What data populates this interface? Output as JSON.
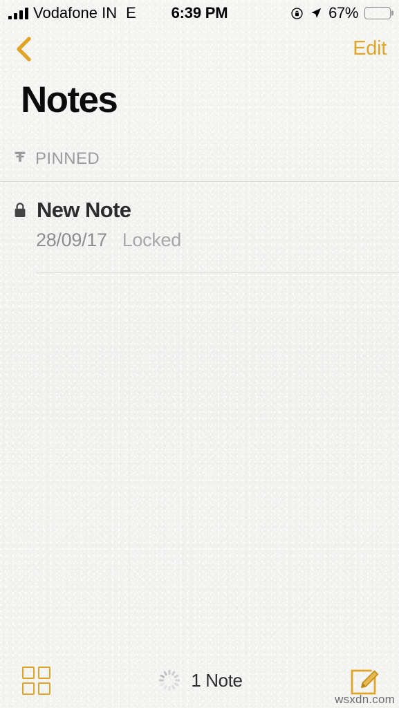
{
  "status_bar": {
    "carrier": "Vodafone IN",
    "network_type": "E",
    "time": "6:39 PM",
    "battery_percent": "67%",
    "battery_level": 67,
    "signal_bars": 4,
    "icons": {
      "signal": "signal-bars-icon",
      "rotation_lock": "rotation-lock-icon",
      "location": "location-arrow-icon",
      "battery": "battery-icon"
    }
  },
  "nav_bar": {
    "back_icon": "chevron-left-icon",
    "edit_label": "Edit"
  },
  "header": {
    "title": "Notes"
  },
  "sections": [
    {
      "icon": "pin-icon",
      "label": "PINNED",
      "notes": [
        {
          "icon": "lock-icon",
          "title": "New Note",
          "date": "28/09/17",
          "status": "Locked"
        }
      ]
    }
  ],
  "toolbar": {
    "grid_icon": "grid-view-icon",
    "spinner_icon": "activity-spinner-icon",
    "note_count": "1 Note",
    "compose_icon": "compose-note-icon"
  },
  "watermark": {
    "text": "wsxdn.com"
  },
  "colors": {
    "accent": "#e0a526",
    "background": "#f3f3f1",
    "title": "#0b0b0b",
    "secondary_text": "#8e8e8e",
    "tertiary_text": "#a7a7a7"
  }
}
